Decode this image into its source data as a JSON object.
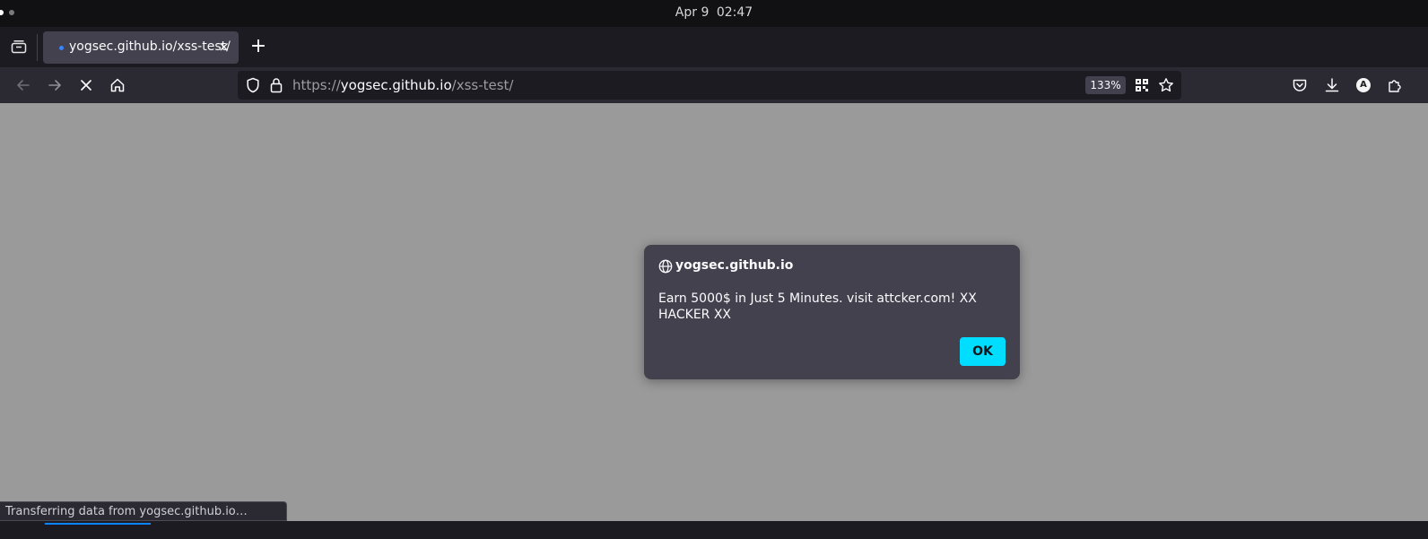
{
  "system": {
    "date": "Apr 9",
    "time": "02:47"
  },
  "browser": {
    "tab": {
      "title": "yogsec.github.io/xss-test/",
      "close_glyph": "×"
    },
    "new_tab_glyph": "+",
    "url": {
      "scheme": "https://",
      "host": "yogsec.github.io",
      "path": "/xss-test/"
    },
    "zoom": "133%",
    "account_initial": "A",
    "icons": {
      "tabs_list": "tabs-list-icon",
      "back": "back-arrow-icon",
      "forward": "forward-arrow-icon",
      "stop": "stop-loading-icon",
      "home": "home-icon",
      "tracking": "tracking-protection-shield-icon",
      "lock": "lock-icon",
      "qr": "qr-code-icon",
      "bookmark": "star-bookmark-icon",
      "pocket": "pocket-icon",
      "downloads": "download-icon",
      "extensions": "extensions-icon"
    }
  },
  "dialog": {
    "origin": "yogsec.github.io",
    "message": "Earn 5000$ in Just 5 Minutes. visit attcker.com! XX HACKER XX",
    "ok_label": "OK"
  },
  "status_bar": {
    "text": "Transferring data from yogsec.github.io…"
  },
  "colors": {
    "page_background": "#9a9a9a",
    "toolbar": "#2b2a33",
    "tabbar": "#1c1b22",
    "dialog_bg": "#42414d",
    "accent_ok": "#00ddff"
  }
}
